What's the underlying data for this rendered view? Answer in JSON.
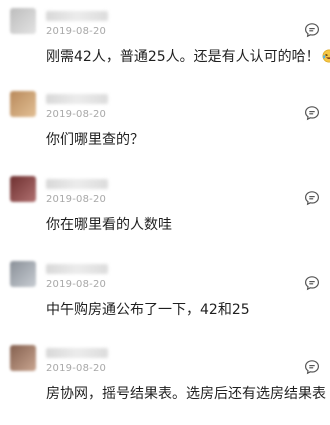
{
  "comments": [
    {
      "date": "2019-08-20",
      "text": "刚需42人，普通25人。还是有人认可的哈！",
      "avatar_color": "#c9c9c9",
      "emoji": "laughing-tears-emoji"
    },
    {
      "date": "2019-08-20",
      "text": "你们哪里查的？",
      "avatar_color": "#c99a6b"
    },
    {
      "date": "2019-08-20",
      "text": "你在哪里看的人数哇",
      "avatar_color": "#8c4a4a"
    },
    {
      "date": "2019-08-20",
      "text": "中午购房通公布了一下，42和25",
      "avatar_color": "#a0a6ad"
    },
    {
      "date": "2019-08-20",
      "text": "房协网，摇号结果表。选房后还有选房结果表",
      "avatar_color": "#9b7a6a"
    }
  ],
  "icons": {
    "reply": "comment-reply-icon"
  }
}
